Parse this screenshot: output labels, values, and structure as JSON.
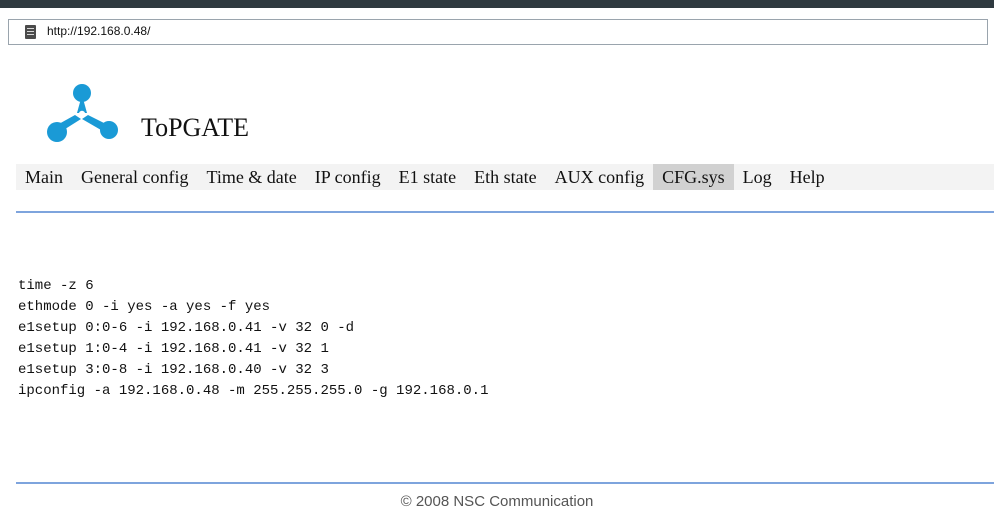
{
  "browser": {
    "url": "http://192.168.0.48/"
  },
  "header": {
    "brand": "ToPGATE",
    "logo_icon": "topgate-logo-icon",
    "logo_color": "#1a9ad6"
  },
  "nav": {
    "items": [
      {
        "label": "Main"
      },
      {
        "label": "General config"
      },
      {
        "label": "Time & date"
      },
      {
        "label": "IP config"
      },
      {
        "label": "E1 state"
      },
      {
        "label": "Eth state"
      },
      {
        "label": "AUX config"
      },
      {
        "label": "CFG.sys",
        "active": true
      },
      {
        "label": "Log"
      },
      {
        "label": "Help"
      }
    ]
  },
  "config": {
    "lines": [
      "time -z 6",
      "ethmode 0 -i yes -a yes -f yes",
      "e1setup 0:0-6 -i 192.168.0.41 -v 32 0 -d",
      "e1setup 1:0-4 -i 192.168.0.41 -v 32 1",
      "e1setup 3:0-8 -i 192.168.0.40 -v 32 3",
      "ipconfig -a 192.168.0.48 -m 255.255.255.0 -g 192.168.0.1"
    ]
  },
  "footer": {
    "text": "© 2008 NSC Communication"
  },
  "colors": {
    "rule": "#7ea4dd",
    "nav_bg": "#f3f3f3",
    "nav_active": "#d1d1d1"
  }
}
